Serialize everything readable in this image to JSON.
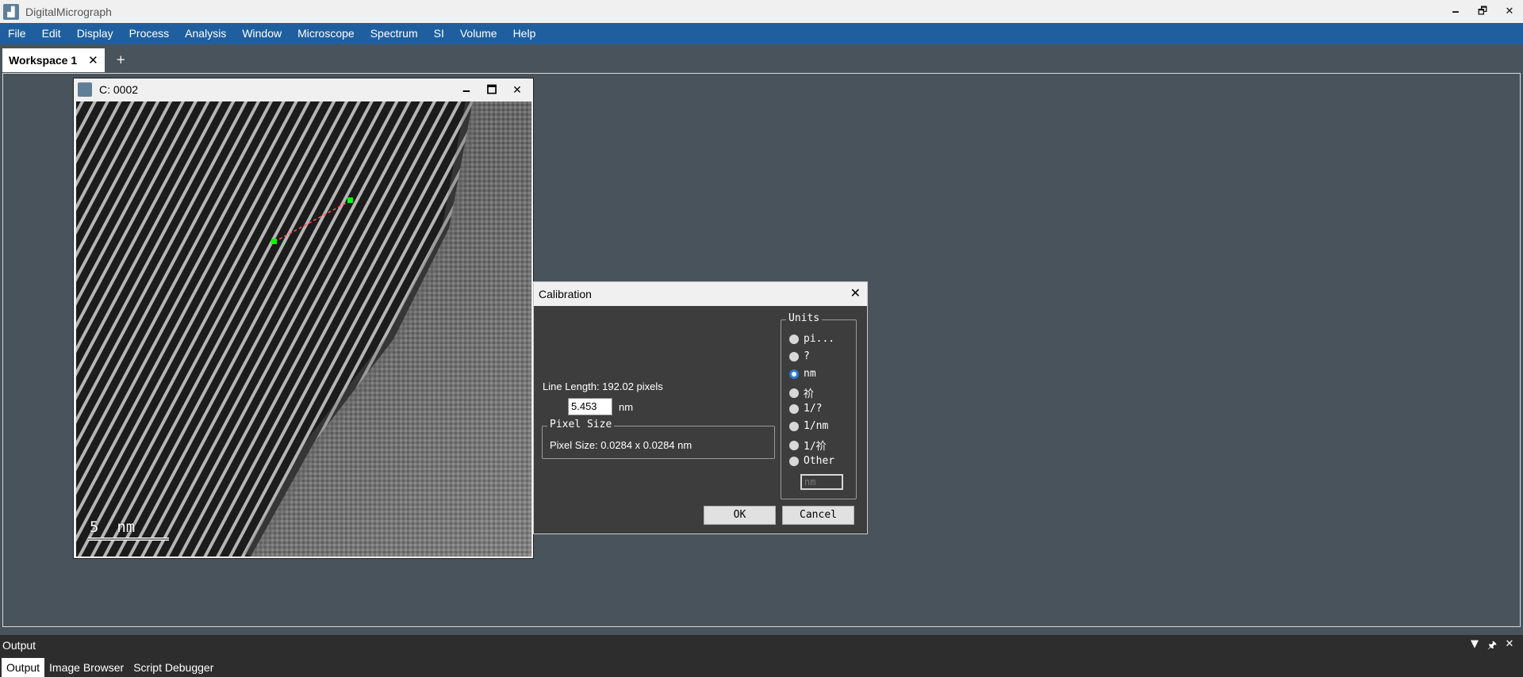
{
  "app": {
    "title": "DigitalMicrograph",
    "min": "🗕",
    "restore": "🗗",
    "close": "✕"
  },
  "menu": [
    "File",
    "Edit",
    "Display",
    "Process",
    "Analysis",
    "Window",
    "Microscope",
    "Spectrum",
    "SI",
    "Volume",
    "Help"
  ],
  "workspace": {
    "tab_label": "Workspace 1",
    "tab_close": "✕",
    "new_tab": "+"
  },
  "image_window": {
    "title": "C: 0002",
    "min": "🗕",
    "max": "🗖",
    "close": "✕",
    "scale_bar_label": "5  nm"
  },
  "calibration": {
    "title": "Calibration",
    "close": "✕",
    "line_length": "Line Length: 192.02 pixels",
    "length_value": "5.453",
    "length_unit": "nm",
    "pixel_size_group": "Pixel Size",
    "pixel_size_text": "Pixel Size: 0.0284 x 0.0284 nm",
    "units_group": "Units",
    "units": [
      {
        "label": "pi...",
        "selected": false
      },
      {
        "label": "?",
        "selected": false
      },
      {
        "label": "nm",
        "selected": true
      },
      {
        "label": "祄",
        "selected": false
      },
      {
        "label": "1/?",
        "selected": false
      },
      {
        "label": "1/nm",
        "selected": false
      },
      {
        "label": "1/祄",
        "selected": false
      },
      {
        "label": "Other",
        "selected": false
      }
    ],
    "other_placeholder": "nm",
    "ok": "OK",
    "cancel": "Cancel"
  },
  "output": {
    "title": "Output",
    "dropdown": "▼",
    "pin": "🖈",
    "close": "✕",
    "tabs": [
      "Output",
      "Image Browser",
      "Script Debugger"
    ]
  },
  "colors": {
    "menubar": "#1f5f9f",
    "workspace": "#49535c",
    "dialog": "#3d3d3d",
    "roi_marker": "#00ff00",
    "roi_line": "#ff5050"
  }
}
